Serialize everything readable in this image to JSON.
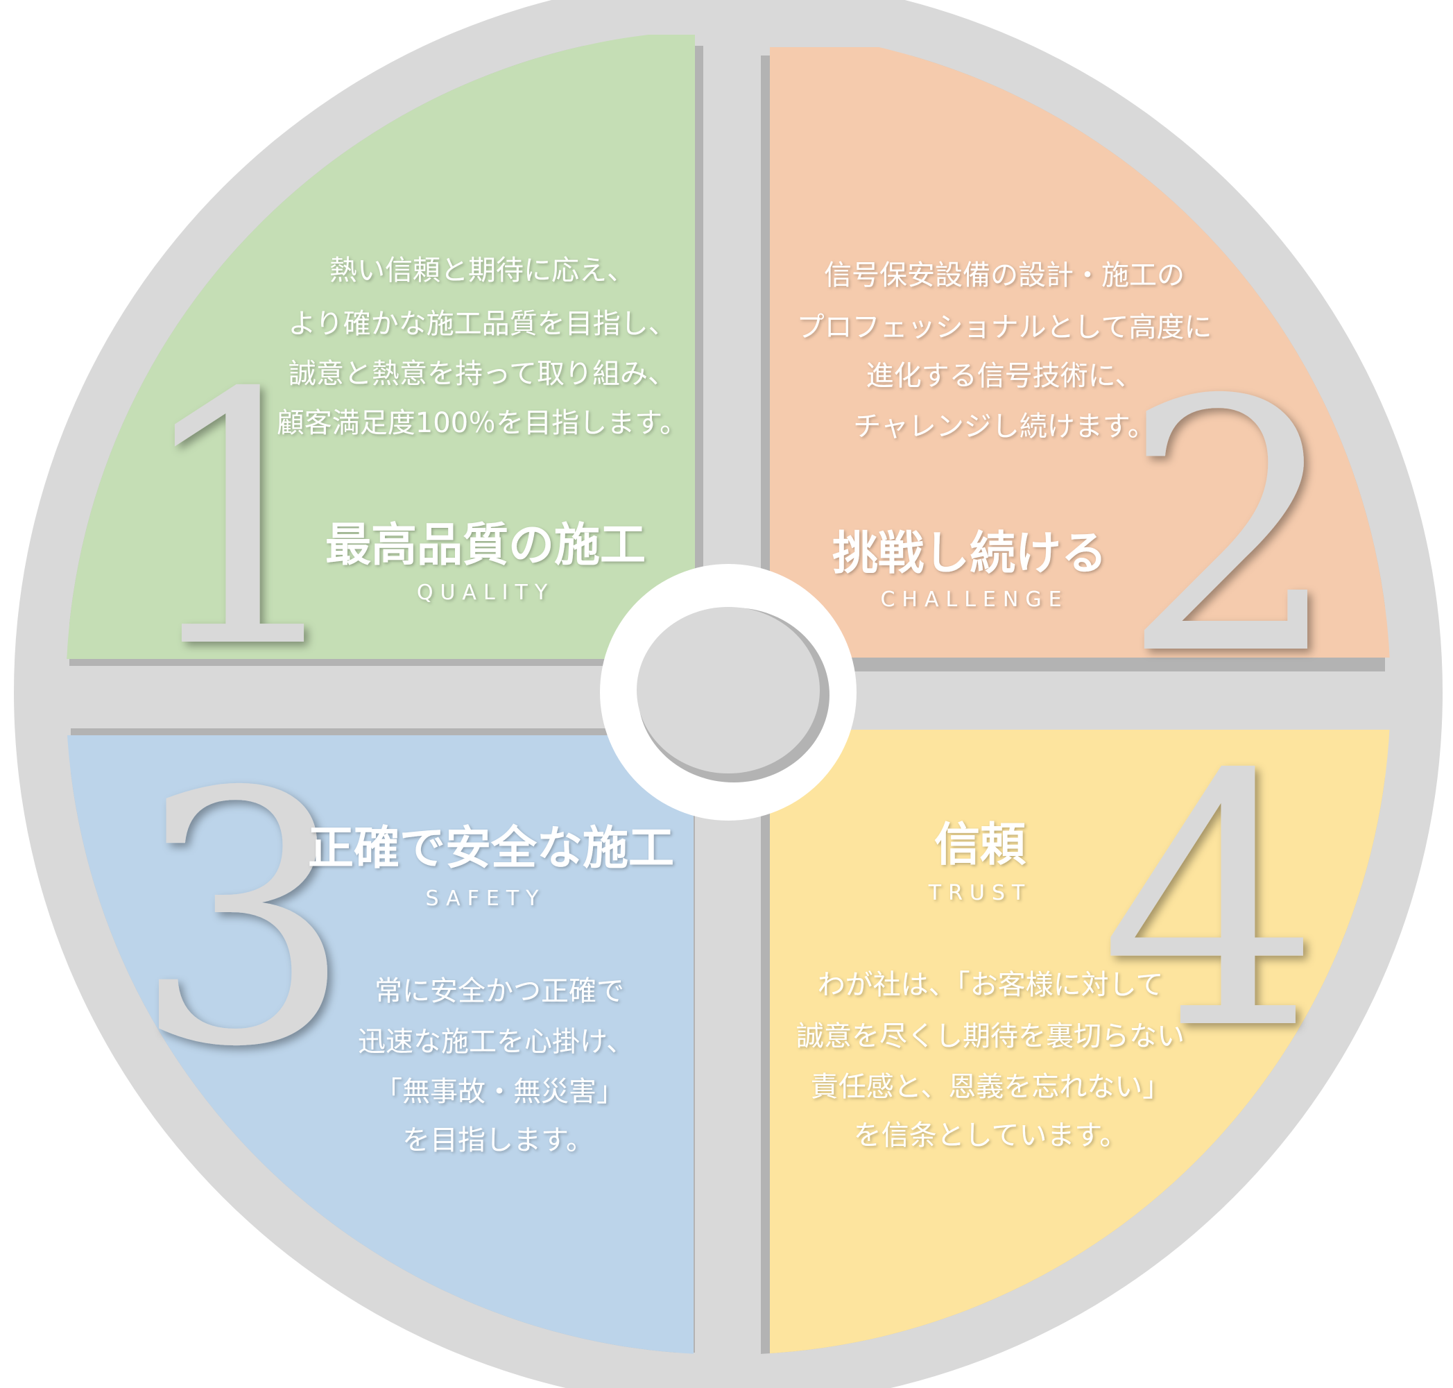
{
  "colors": {
    "ring": "#d9d9d9",
    "ring_shadow": "#b3b3b3",
    "q1": "#c5deb5",
    "q2": "#f5cbad",
    "q3": "#bcd4ea",
    "q4": "#fde49e",
    "hub_ring": "#ffffff",
    "hub_center": "#d9d9d9",
    "text": "#ffffff",
    "numeral": "#d9d9d9"
  },
  "sections": [
    {
      "number": "1",
      "title": "最高品質の施工",
      "subtitle": "QUALITY",
      "body": [
        "熱い信頼と期待に応え、",
        "より確かな施工品質を目指し、",
        "誠意と熱意を持って取り組み、",
        "顧客満足度100％を目指します。"
      ]
    },
    {
      "number": "2",
      "title": "挑戦し続ける",
      "subtitle": "CHALLENGE",
      "body": [
        "信号保安設備の設計・施工の",
        "プロフェッショナルとして高度に",
        "進化する信号技術に、",
        "チャレンジし続けます。"
      ]
    },
    {
      "number": "3",
      "title": "正確で安全な施工",
      "subtitle": "SAFETY",
      "body": [
        "常に安全かつ正確で",
        "迅速な施工を心掛け、",
        "「無事故・無災害」",
        "を目指します。"
      ]
    },
    {
      "number": "4",
      "title": "信頼",
      "subtitle": "TRUST",
      "body": [
        "わが社は、「お客様に対して",
        "誠意を尽くし期待を裏切らない",
        "責任感と、恩義を忘れない」",
        "を信条としています。"
      ]
    }
  ]
}
